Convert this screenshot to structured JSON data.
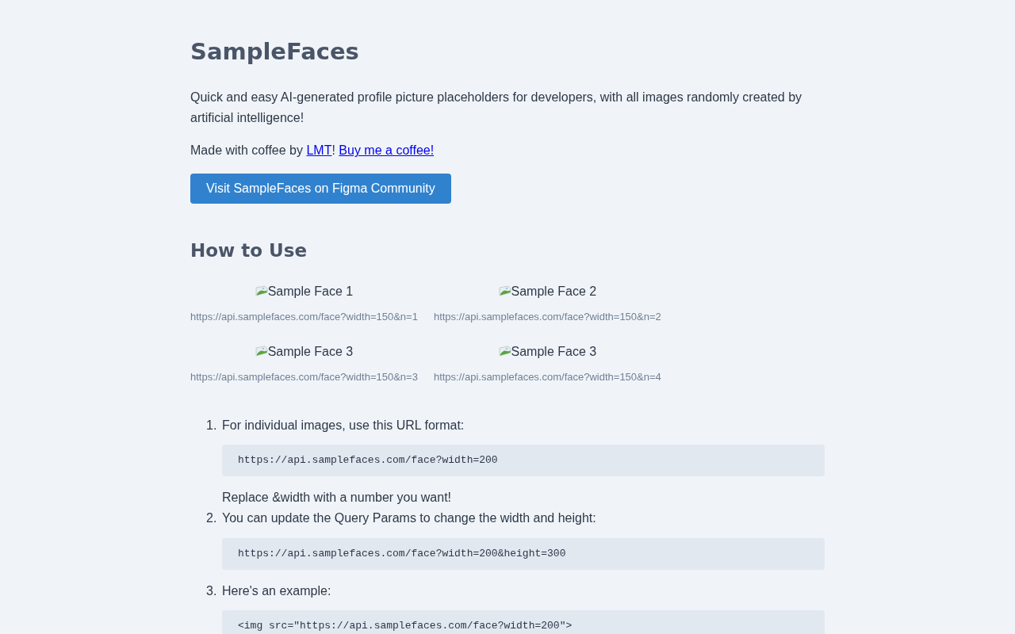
{
  "title": "SampleFaces",
  "intro": "Quick and easy AI-generated profile picture placeholders for developers, with all images randomly created by artificial intelligence!",
  "credit": [
    {
      "kind": "text",
      "text": "Made with coffee by "
    },
    {
      "kind": "link",
      "text": "LMT"
    },
    {
      "kind": "text",
      "text": "! "
    },
    {
      "kind": "link",
      "text": "Buy me a coffee!"
    }
  ],
  "figma_button": "Visit SampleFaces on Figma Community",
  "how_to_use": {
    "heading": "How to Use",
    "samples": [
      {
        "alt": "Sample Face 1",
        "url": "https://api.samplefaces.com/face?width=150&n=1"
      },
      {
        "alt": "Sample Face 2",
        "url": "https://api.samplefaces.com/face?width=150&n=2"
      },
      {
        "alt": "Sample Face 3",
        "url": "https://api.samplefaces.com/face?width=150&n=3"
      },
      {
        "alt": "Sample Face 3",
        "url": "https://api.samplefaces.com/face?width=150&n=4"
      }
    ],
    "steps": [
      {
        "number": "1.",
        "text": "For individual images, use this URL format:",
        "code": "https://api.samplefaces.com/face?width=200",
        "note": "Replace &width with a number you want!"
      },
      {
        "number": "2.",
        "text": "You can update the Query Params to change the width and height:",
        "code": "https://api.samplefaces.com/face?width=200&height=300"
      },
      {
        "number": "3.",
        "text": "Here's an example:",
        "code": "<img src=\"https://api.samplefaces.com/face?width=200\">"
      }
    ]
  }
}
